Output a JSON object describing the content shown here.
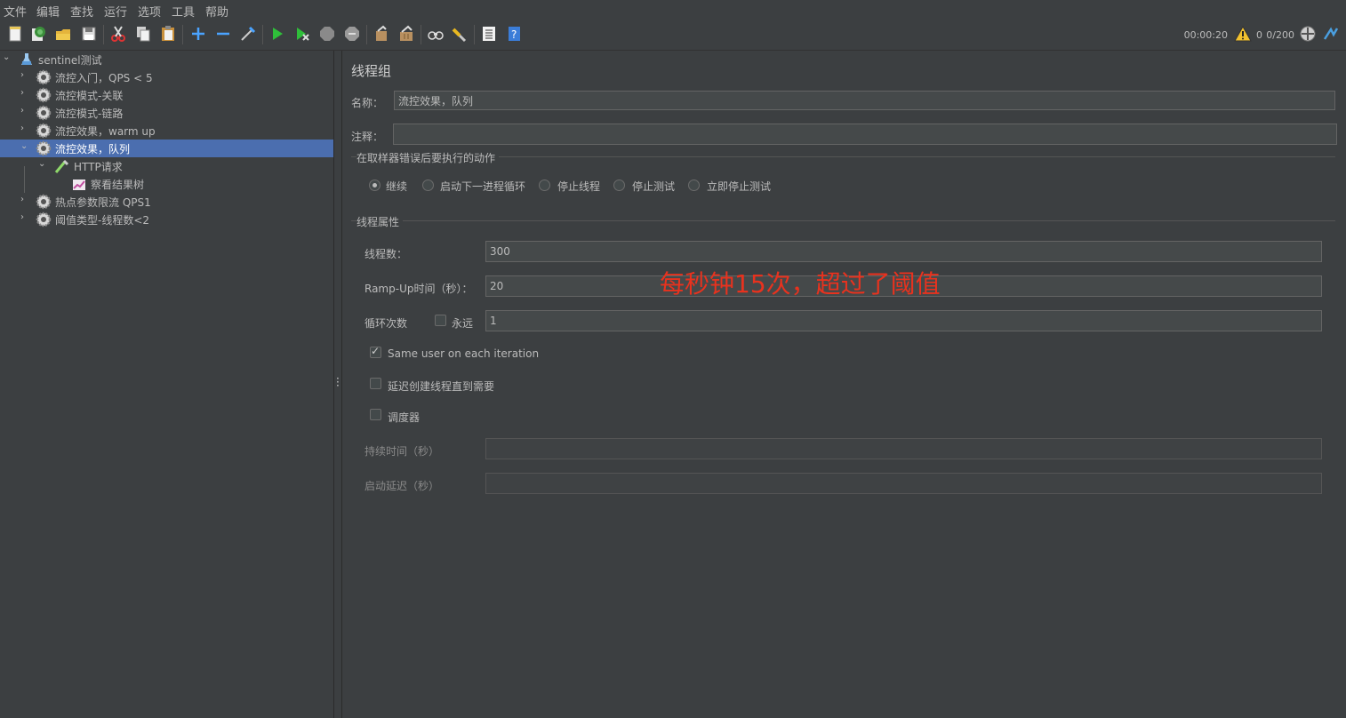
{
  "menu": [
    "文件",
    "编辑",
    "查找",
    "运行",
    "选项",
    "工具",
    "帮助"
  ],
  "toolbar_icons": [
    "new-icon",
    "templates-icon",
    "open-icon",
    "save-icon",
    "cut-icon",
    "copy-icon",
    "paste-icon",
    "expand-icon",
    "collapse-icon",
    "toggle-icon",
    "start-icon",
    "start-no-pauses-icon",
    "stop-icon",
    "shutdown-icon",
    "clear-icon",
    "clear-all-icon",
    "search-icon",
    "reset-search-icon",
    "function-helper-icon",
    "help-icon"
  ],
  "status": {
    "time": "00:00:20",
    "warnings": "0",
    "threads": "0/200"
  },
  "tree": {
    "root": "sentinel测试",
    "items": [
      {
        "label": "流控入门，QPS < 5"
      },
      {
        "label": "流控模式-关联"
      },
      {
        "label": "流控模式-链路"
      },
      {
        "label": "流控效果，warm up"
      },
      {
        "label": "流控效果，队列",
        "selected": true
      },
      {
        "label": "HTTP请求"
      },
      {
        "label": "察看结果树"
      },
      {
        "label": "热点参数限流 QPS1"
      },
      {
        "label": "阈值类型-线程数<2"
      }
    ]
  },
  "panel": {
    "title": "线程组",
    "name_label": "名称：",
    "name_value": "流控效果，队列",
    "comment_label": "注释：",
    "comment_value": "",
    "error_section": "在取样器错误后要执行的动作",
    "error_options": [
      "继续",
      "启动下一进程循环",
      "停止线程",
      "停止测试",
      "立即停止测试"
    ],
    "thread_section": "线程属性",
    "threads_label": "线程数：",
    "threads_value": "300",
    "rampup_label": "Ramp-Up时间（秒）：",
    "rampup_value": "20",
    "loop_label": "循环次数",
    "forever_label": "永远",
    "loop_value": "1",
    "same_user_label": "Same user on each iteration",
    "delay_label": "延迟创建线程直到需要",
    "scheduler_label": "调度器",
    "duration_label": "持续时间（秒）",
    "startup_label": "启动延迟（秒）"
  },
  "annotation": "每秒钟15次，超过了阈值"
}
